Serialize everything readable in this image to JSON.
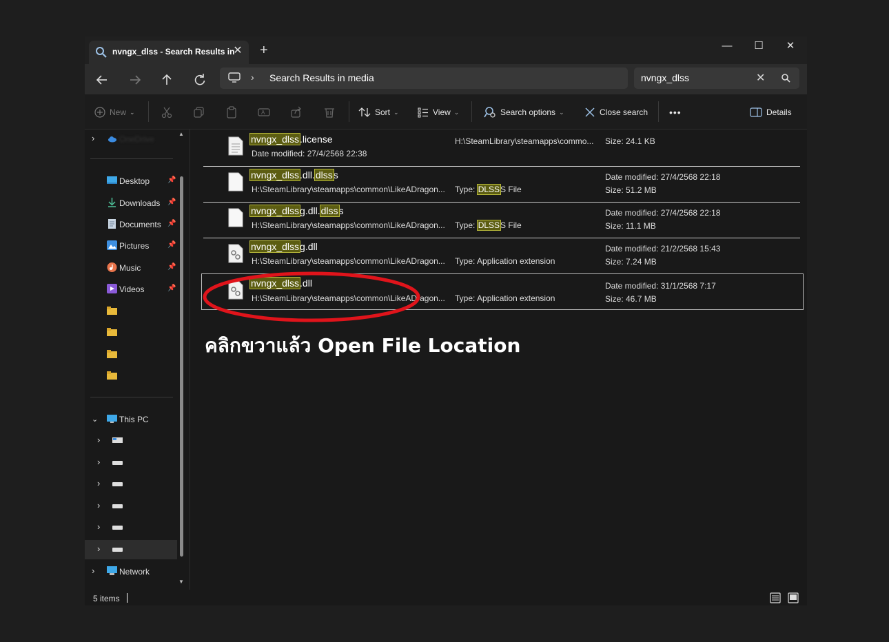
{
  "tab": {
    "title": "nvngx_dlss - Search Results in",
    "close": "✕",
    "new": "+"
  },
  "window_controls": {
    "minimize": "—",
    "maximize": "☐",
    "close": "✕"
  },
  "nav": {
    "breadcrumb_chevron": "›",
    "breadcrumb": "Search Results in media"
  },
  "search": {
    "value": "nvngx_dlss",
    "clear": "✕"
  },
  "toolbar": {
    "new_label": "New",
    "sort_label": "Sort",
    "view_label": "View",
    "search_options_label": "Search options",
    "close_search_label": "Close search",
    "more_label": "•••",
    "details_label": "Details"
  },
  "sidebar": {
    "quick_access": [
      {
        "label": "Desktop"
      },
      {
        "label": "Downloads"
      },
      {
        "label": "Documents"
      },
      {
        "label": "Pictures"
      },
      {
        "label": "Music"
      },
      {
        "label": "Videos"
      }
    ],
    "this_pc_label": "This PC",
    "network_label": "Network"
  },
  "results": [
    {
      "highlight": "nvngx_dlss",
      "rest_parts": [
        ".license"
      ],
      "line2": "Date modified: 27/4/2568 22:38",
      "middle": "H:\\SteamLibrary\\steamapps\\commo...",
      "right1": "Size: 24.1 KB",
      "right2": ""
    },
    {
      "highlight": "nvngx_dlss",
      "rest_parts": [
        ".dll.",
        "dlss",
        "s"
      ],
      "line2": "H:\\SteamLibrary\\steamapps\\common\\LikeADragon...",
      "type_prefix": "Type: ",
      "type_hl": "DLSS",
      "type_rest": "S File",
      "right1": "Date modified: 27/4/2568 22:18",
      "right2": "Size: 51.2 MB"
    },
    {
      "highlight": "nvngx_dlss",
      "rest_parts": [
        "g.dll.",
        "dlss",
        "s"
      ],
      "line2": "H:\\SteamLibrary\\steamapps\\common\\LikeADragon...",
      "type_prefix": "Type: ",
      "type_hl": "DLSS",
      "type_rest": "S File",
      "right1": "Date modified: 27/4/2568 22:18",
      "right2": "Size: 11.1 MB"
    },
    {
      "highlight": "nvngx_dlss",
      "rest_parts": [
        "g.dll"
      ],
      "line2": "H:\\SteamLibrary\\steamapps\\common\\LikeADragon...",
      "type": "Type: Application extension",
      "right1": "Date modified: 21/2/2568 15:43",
      "right2": "Size: 7.24 MB"
    },
    {
      "highlight": "nvngx_dlss",
      "rest_parts": [
        ".dll"
      ],
      "line2": "H:\\SteamLibrary\\steamapps\\common\\LikeADragon...",
      "type": "Type: Application extension",
      "right1": "Date modified: 31/1/2568 7:17",
      "right2": "Size: 46.7 MB"
    }
  ],
  "annotation": {
    "text": "คลิกขวาแล้ว Open File Location",
    "color": "#e0141b"
  },
  "status": {
    "count": "5 items"
  },
  "colors": {
    "highlight_bg": "#5c5d12",
    "highlight_border": "#b7b83a",
    "window_bg": "#191919"
  }
}
